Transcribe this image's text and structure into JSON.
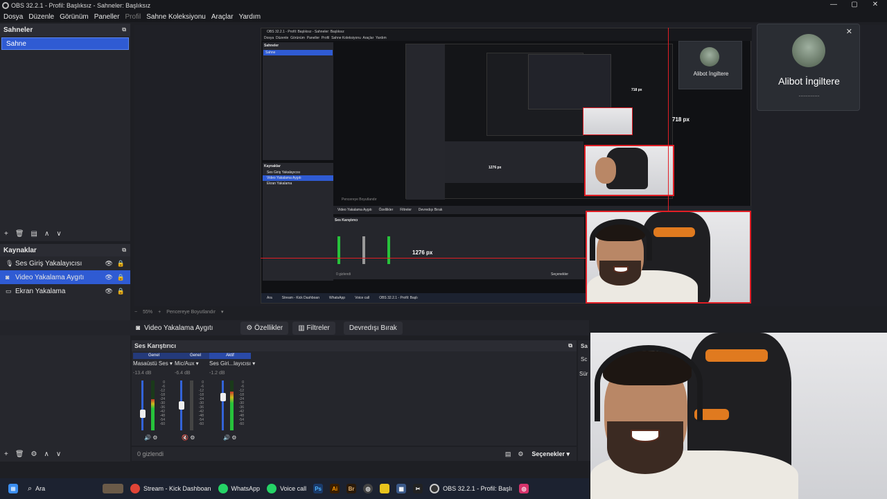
{
  "window": {
    "title": "OBS 32.2.1 - Profil: Başlıksız - Sahneler: Başlıksız",
    "minimize": "—",
    "maximize": "▢",
    "close": "✕"
  },
  "menu": [
    "Dosya",
    "Düzenle",
    "Görünüm",
    "Paneller",
    "Profil",
    "Sahne Koleksiyonu",
    "Araçlar",
    "Yardım"
  ],
  "scenes_panel": {
    "title": "Sahneler",
    "items": [
      "Sahne"
    ]
  },
  "sources_panel": {
    "title": "Kaynaklar",
    "items": [
      {
        "label": "Ses Giriş Yakalayıcısı",
        "icon": "microphone-icon",
        "selected": false
      },
      {
        "label": "Video Yakalama Aygıtı",
        "icon": "camera-icon",
        "selected": true
      },
      {
        "label": "Ekran Yakalama",
        "icon": "monitor-icon",
        "selected": false
      }
    ]
  },
  "toolbar_icons": [
    "+",
    "🗑",
    "⚙",
    "∧",
    "∨"
  ],
  "preview": {
    "label_718": "718 px",
    "label_1276": "1276 px",
    "nested_718": "718 px",
    "nested_1276": "1276 px"
  },
  "context_bar": {
    "source_name": "Video Yakalama Aygıtı",
    "properties": "Özellikler",
    "filters": "Filtreler",
    "deactivate": "Devredışı Bırak"
  },
  "mixer": {
    "title": "Ses Karıştırıcı",
    "channels": [
      {
        "badge": "Genel",
        "name": "Masaüstü Ses",
        "db": "-13.4 dB",
        "level": 0.62,
        "muted": false
      },
      {
        "badge": "Genel",
        "name": "Mic/Aux",
        "db": "-6.4 dB",
        "level": 0.0,
        "muted": true
      },
      {
        "badge": "Aktif",
        "name": "Ses Giri...layıcısı",
        "db": "-1.2 dB",
        "level": 0.78,
        "muted": false
      }
    ],
    "tick_labels": [
      "0",
      "-6",
      "-12",
      "-18",
      "-24",
      "-30",
      "-36",
      "-42",
      "-48",
      "-54",
      "-60"
    ],
    "hidden": "0 gizlendi",
    "options": "Seçenekler"
  },
  "side_panel_fragment": {
    "a": "Sa",
    "b": "Sc",
    "c": "Sür"
  },
  "popup": {
    "name": "Alibot İngiltere",
    "dots": "............"
  },
  "nested_popup": {
    "name": "Alibot İngiltere"
  },
  "taskbar": {
    "search": "Ara",
    "items": [
      {
        "label": "Stream - Kick Dashboan",
        "icon": "chrome-icon",
        "color": "#e04436"
      },
      {
        "label": "WhatsApp",
        "icon": "whatsapp-icon",
        "color": "#25d366"
      },
      {
        "label": "Voice call",
        "icon": "whatsapp-call-icon",
        "color": "#25d366"
      },
      {
        "label": "",
        "icon": "photoshop-icon",
        "color": "#1a73c8",
        "glyph": "Ps"
      },
      {
        "label": "",
        "icon": "illustrator-icon",
        "color": "#cc6a00",
        "glyph": "Ai"
      },
      {
        "label": "",
        "icon": "bridge-icon",
        "color": "#3a2a1a",
        "glyph": "Br"
      },
      {
        "label": "",
        "icon": "xbox-icon",
        "color": "#444",
        "glyph": "◎"
      },
      {
        "label": "",
        "icon": "notes-icon",
        "color": "#e8c31c",
        "glyph": ""
      },
      {
        "label": "",
        "icon": "calculator-icon",
        "color": "#3b5a8a",
        "glyph": "▦"
      },
      {
        "label": "",
        "icon": "capcut-icon",
        "color": "#222",
        "glyph": "✂"
      },
      {
        "label": "OBS 32.2.1 - Profil: Başlı",
        "icon": "obs-icon",
        "color": "#333"
      },
      {
        "label": "",
        "icon": "instagram-icon",
        "color": "#d6336c",
        "glyph": "◎"
      }
    ]
  },
  "preview_statusbar": {
    "zoom": "55%",
    "fit": "Pencereye Boyutlandır"
  },
  "nested_ui": {
    "title": "OBS 32.2.1 - Profil: Başlıksız - Sahneler: Başlıksız",
    "menu": [
      "Dosya",
      "Düzenle",
      "Görünüm",
      "Paneller",
      "Profil",
      "Sahne Koleksiyonu",
      "Araçlar",
      "Yardım"
    ],
    "scenes_title": "Sahneler",
    "scene": "Sahne",
    "sources_title": "Kaynaklar",
    "sources": [
      "Ses Giriş Yakalayıcısı",
      "Video Yakalama Aygıtı",
      "Ekran Yakalama"
    ],
    "ctx_source": "Video Yakalama Aygıtı",
    "ctx_props": "Özellikler",
    "ctx_filters": "Filtreler",
    "ctx_deact": "Devredışı Bırak",
    "mixer_title": "Ses Karıştırıcı",
    "taskbar_search": "Ara",
    "taskbar_items": [
      "Stream - Kick Dashboan",
      "WhatsApp",
      "Voice call",
      "OBS 32.2.1 - Profil: Başlı"
    ],
    "mixer_hidden": "0 gizlendi",
    "mixer_options": "Seçenekler",
    "nested_statusbar": "Pencereye Boyutlandır",
    "nested_px": "718 px",
    "nested_px_h": "1276 px"
  }
}
